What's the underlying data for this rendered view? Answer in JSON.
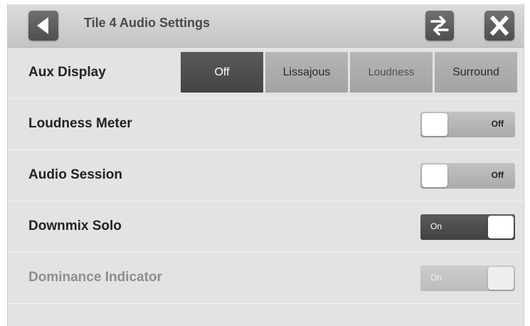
{
  "header": {
    "title": "Tile 4 Audio Settings",
    "back_icon": "back-arrow-icon",
    "swap_icon": "swap-arrows-icon",
    "close_icon": "close-x-icon"
  },
  "rows": {
    "aux_display": {
      "label": "Aux Display",
      "options": [
        "Off",
        "Lissajous",
        "Loudness",
        "Surround"
      ],
      "selected": "Off"
    },
    "loudness_meter": {
      "label": "Loudness Meter",
      "state": "Off"
    },
    "audio_session": {
      "label": "Audio Session",
      "state": "Off"
    },
    "downmix_solo": {
      "label": "Downmix Solo",
      "state": "On"
    },
    "dominance_indicator": {
      "label": "Dominance Indicator",
      "state": "On",
      "disabled": true
    }
  },
  "colors": {
    "selected_segment": "#4f4f4f",
    "segment": "#acacac",
    "panel_bg": "#e3e3e3",
    "toggle_on": "#4e4e4e"
  }
}
